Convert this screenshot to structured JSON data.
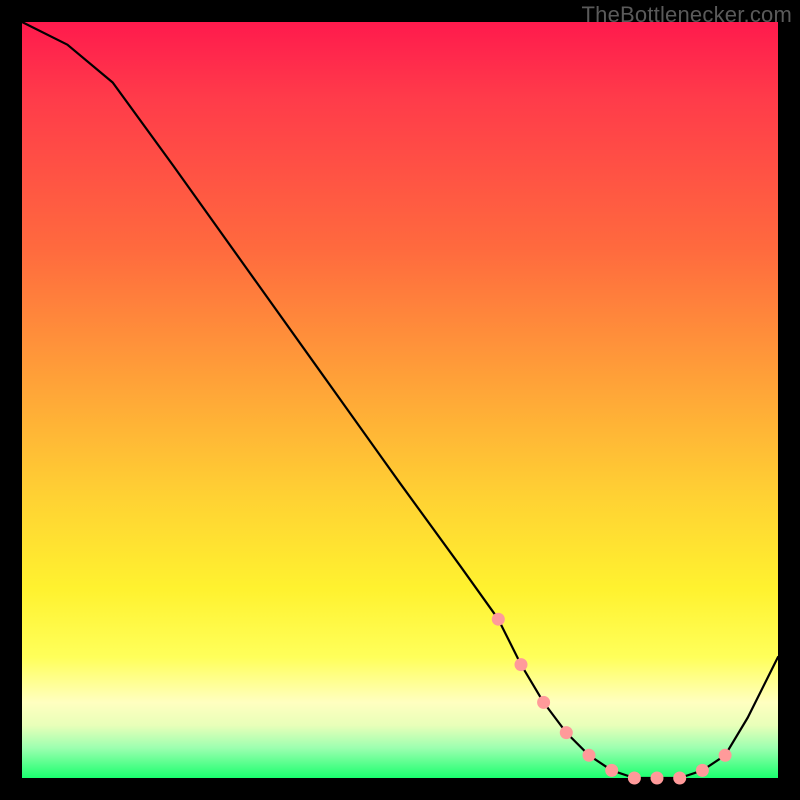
{
  "watermark": "TheBottlenecker.com",
  "chart_data": {
    "type": "line",
    "title": "",
    "xlabel": "",
    "ylabel": "",
    "xlim": [
      0,
      100
    ],
    "ylim": [
      0,
      100
    ],
    "series": [
      {
        "name": "curve",
        "x": [
          0,
          6,
          12,
          20,
          30,
          40,
          50,
          58,
          63,
          66,
          69,
          72,
          75,
          78,
          81,
          84,
          87,
          90,
          93,
          96,
          100
        ],
        "y": [
          100,
          97,
          92,
          81,
          67,
          53,
          39,
          28,
          21,
          15,
          10,
          6,
          3,
          1,
          0,
          0,
          0,
          1,
          3,
          8,
          16
        ]
      }
    ],
    "markers": {
      "name": "highlight-points",
      "color": "#ff9a9a",
      "x": [
        63,
        66,
        69,
        72,
        75,
        78,
        81,
        84,
        87,
        90,
        93
      ],
      "y": [
        21,
        15,
        10,
        6,
        3,
        1,
        0,
        0,
        0,
        1,
        3
      ]
    }
  }
}
